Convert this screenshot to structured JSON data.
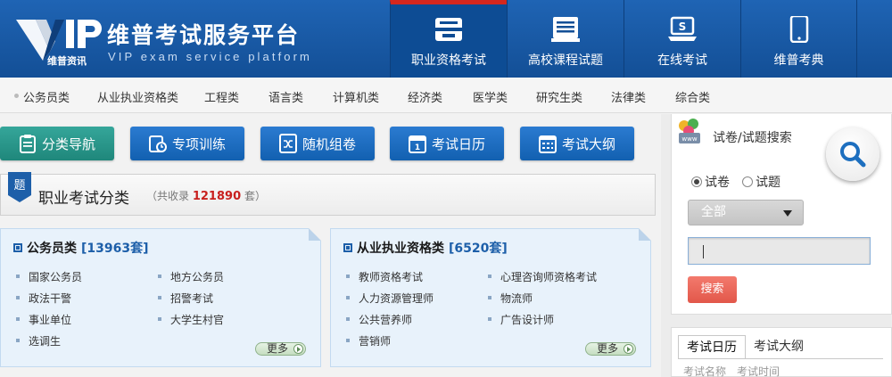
{
  "header": {
    "logo_text": "VIP",
    "logo_sub": "维普资讯",
    "title": "维普考试服务平台",
    "subtitle": "VIP exam service platform",
    "nav": [
      {
        "label": "职业资格考试",
        "icon": "exam-book-icon",
        "active": true
      },
      {
        "label": "高校课程试题",
        "icon": "document-list-icon",
        "active": false
      },
      {
        "label": "在线考试",
        "icon": "laptop-icon",
        "active": false
      },
      {
        "label": "维普考典",
        "icon": "tablet-icon",
        "active": false
      }
    ]
  },
  "categories": [
    "公务员类",
    "从业执业资格类",
    "工程类",
    "语言类",
    "计算机类",
    "经济类",
    "医学类",
    "研究生类",
    "法律类",
    "综合类"
  ],
  "actions": [
    {
      "label": "分类导航",
      "icon": "clipboard-icon"
    },
    {
      "label": "专项训练",
      "icon": "timer-icon"
    },
    {
      "label": "随机组卷",
      "icon": "shuffle-icon"
    },
    {
      "label": "考试日历",
      "icon": "calendar-icon"
    },
    {
      "label": "考试大纲",
      "icon": "outline-icon"
    }
  ],
  "section": {
    "tag": "题",
    "title": "职业考试分类",
    "meta_prefix": "（共收录",
    "meta_count": "121890",
    "meta_suffix": "套）"
  },
  "cards": [
    {
      "title": "公务员类",
      "count": "[13963套]",
      "items": [
        "国家公务员",
        "地方公务员",
        "政法干警",
        "招警考试",
        "事业单位",
        "大学生村官",
        "选调生"
      ],
      "more": "更多"
    },
    {
      "title": "从业执业资格类",
      "count": "[6520套]",
      "items": [
        "教师资格考试",
        "心理咨询师资格考试",
        "人力资源管理师",
        "物流师",
        "公共营养师",
        "广告设计师",
        "营销师"
      ],
      "more": "更多"
    }
  ],
  "search": {
    "title": "试卷/试题搜索",
    "radio_paper": "试卷",
    "radio_question": "试题",
    "selected_radio": "试卷",
    "select_value": "全部",
    "input_value": "",
    "button": "搜索"
  },
  "calendar": {
    "tabs": [
      "考试日历",
      "考试大纲"
    ],
    "col_name": "考试名称",
    "col_time": "考试时间"
  },
  "colors": {
    "header_blue": "#1a5aa6",
    "active_red": "#d5271d",
    "accent_blue": "#1d5fa9",
    "count_red": "#c8201e",
    "teal": "#2a978a",
    "search_red": "#e8635a"
  }
}
